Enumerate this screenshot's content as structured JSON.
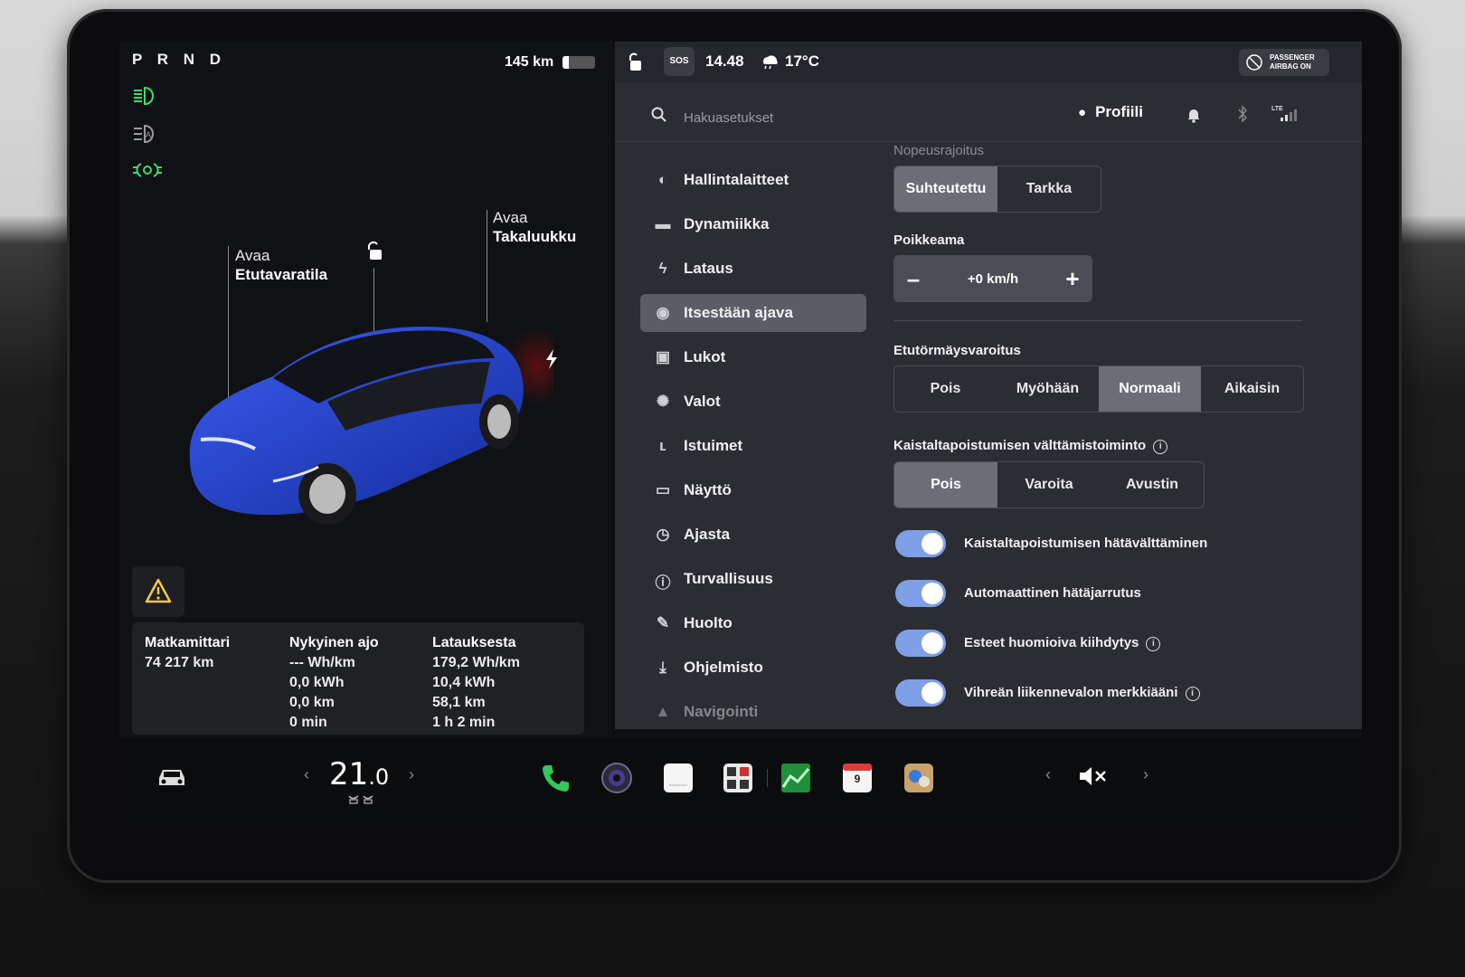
{
  "left": {
    "gear": "P R N D",
    "range": "145 km",
    "battery_fraction": 0.2,
    "callout_frunk": {
      "line1": "Avaa",
      "line2": "Etutavaratila"
    },
    "callout_trunk": {
      "line1": "Avaa",
      "line2": "Takaluukku"
    },
    "car_color": "#1f3fd0",
    "stats": [
      {
        "title": "Matkamittari",
        "lines": [
          "74 217 km"
        ]
      },
      {
        "title": "Nykyinen ajo",
        "lines": [
          "--- Wh/km",
          "0,0 kWh",
          "0,0 km",
          "0 min"
        ]
      },
      {
        "title": "Latauksesta",
        "lines": [
          "179,2 Wh/km",
          "10,4 kWh",
          "58,1 km",
          "1 h 2 min"
        ]
      }
    ]
  },
  "statusbar": {
    "sos": "SOS",
    "time": "14.48",
    "temperature": "17°C",
    "airbag_line1": "PASSENGER",
    "airbag_line2": "AIRBAG ON"
  },
  "search": {
    "placeholder": "Hakuasetukset"
  },
  "profile": {
    "label": "Profiili"
  },
  "nav": [
    {
      "label": "Hallintalaitteet",
      "icon": "toggle-icon"
    },
    {
      "label": "Dynamiikka",
      "icon": "car-icon"
    },
    {
      "label": "Lataus",
      "icon": "bolt-icon"
    },
    {
      "label": "Itsestään ajava",
      "icon": "steering-wheel-icon",
      "active": true
    },
    {
      "label": "Lukot",
      "icon": "lock-icon"
    },
    {
      "label": "Valot",
      "icon": "sun-icon"
    },
    {
      "label": "Istuimet",
      "icon": "seat-icon"
    },
    {
      "label": "Näyttö",
      "icon": "display-icon"
    },
    {
      "label": "Ajasta",
      "icon": "clock-icon"
    },
    {
      "label": "Turvallisuus",
      "icon": "info-circle-icon"
    },
    {
      "label": "Huolto",
      "icon": "wrench-icon"
    },
    {
      "label": "Ohjelmisto",
      "icon": "download-icon"
    },
    {
      "label": "Navigointi",
      "icon": "navigation-icon"
    }
  ],
  "content": {
    "speed_limit": {
      "label": "Nopeusrajoitus",
      "options": [
        "Suhteutettu",
        "Tarkka"
      ],
      "selected": 0
    },
    "offset": {
      "label": "Poikkeama",
      "minus": "–",
      "value": "+0 km/h",
      "plus": "+"
    },
    "fcw": {
      "label": "Etutörmäysvaroitus",
      "options": [
        "Pois",
        "Myöhään",
        "Normaali",
        "Aikaisin"
      ],
      "selected": 2
    },
    "lane": {
      "label": "Kaistaltapoistumisen välttämistoiminto",
      "options": [
        "Pois",
        "Varoita",
        "Avustin"
      ],
      "selected": 0
    },
    "toggles": [
      {
        "label": "Kaistaltapoistumisen hätävälttäminen",
        "on": true,
        "info": false
      },
      {
        "label": "Automaattinen hätäjarrutus",
        "on": true,
        "info": false
      },
      {
        "label": "Esteet huomioiva kiihdytys",
        "on": true,
        "info": true
      },
      {
        "label": "Vihreän liikennevalon merkkiääni",
        "on": true,
        "info": true
      }
    ]
  },
  "dock": {
    "temp_int": "21",
    "temp_dec": ".0",
    "calendar_day": "9"
  },
  "colors": {
    "accent_toggle": "#7f9fe6",
    "lamp_green": "#3ddc6a"
  }
}
